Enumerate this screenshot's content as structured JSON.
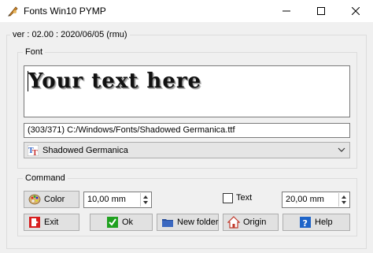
{
  "window": {
    "title": "Fonts Win10 PYMP",
    "icons": {
      "app": "feather-pen-icon",
      "minimize": "minimize-icon",
      "maximize": "maximize-icon",
      "close": "close-icon"
    }
  },
  "version_label": "ver : 02.00 : 2020/06/05 (rmu)",
  "font_group": {
    "label": "Font",
    "preview_text": "Your text here",
    "path": "(303/371) C:/Windows/Fonts/Shadowed Germanica.ttf",
    "selected_font": "Shadowed Germanica",
    "font_type_icon": "truetype-icon"
  },
  "command_group": {
    "label": "Command",
    "color_button": "Color",
    "size_value_left": "10,00 mm",
    "text_checkbox_label": "Text",
    "text_checkbox_checked": false,
    "size_value_right": "20,00 mm",
    "buttons": {
      "exit": "Exit",
      "ok": "Ok",
      "new_folder": "New folder",
      "origin": "Origin",
      "help": "Help"
    }
  },
  "colors": {
    "exit_icon": "#d81e1e",
    "ok_icon": "#1fa11f",
    "help_icon": "#1e64c8",
    "folder_icon": "#2a4f9a",
    "origin_icon": "#c0392b"
  }
}
